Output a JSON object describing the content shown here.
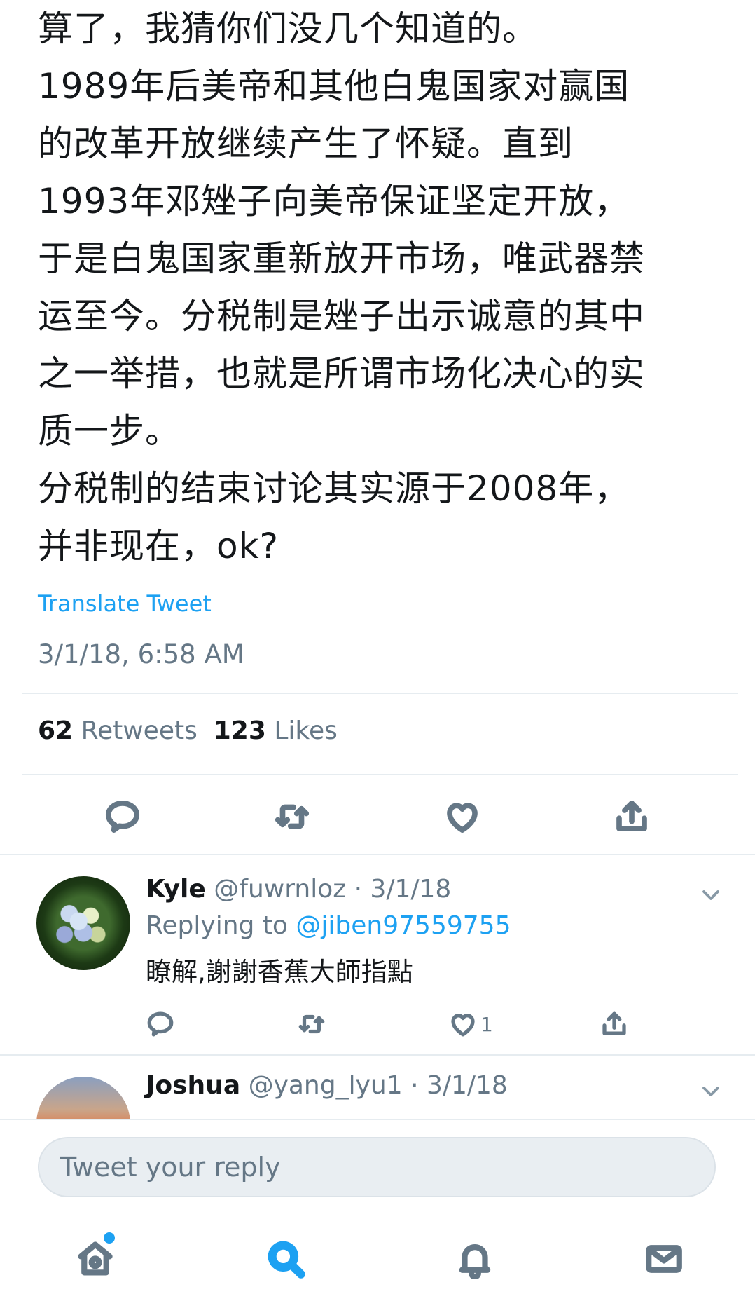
{
  "tweet": {
    "lines": [
      "算了，我猜你们没几个知道的。",
      "1989年后美帝和其他白鬼国家对赢国",
      "的改革开放继续产生了怀疑。直到",
      "1993年邓矬子向美帝保证坚定开放，",
      "于是白鬼国家重新放开市场，唯武器禁",
      "运至今。分税制是矬子出示诚意的其中",
      "之一举措，也就是所谓市场化决心的实",
      "质一步。",
      "分税制的结束讨论其实源于2008年，",
      "并非现在，ok?"
    ],
    "translate_label": "Translate Tweet",
    "timestamp": "3/1/18, 6:58 AM",
    "retweets_count": "62",
    "retweets_label": "Retweets",
    "likes_count": "123",
    "likes_label": "Likes"
  },
  "replies": [
    {
      "name": "Kyle",
      "handle": "@fuwrnloz",
      "date": "· 3/1/18",
      "replying_prefix": "Replying to",
      "replying_handle": "@jiben97559755",
      "text": "瞭解,謝謝香蕉大師指點",
      "like_count": "1"
    },
    {
      "name": "Joshua",
      "handle": "@yang_lyu1",
      "date": "· 3/1/18"
    }
  ],
  "compose": {
    "placeholder": "Tweet your reply"
  },
  "icons": {
    "reply": "reply-icon",
    "retweet": "retweet-icon",
    "like": "like-icon",
    "share": "share-icon",
    "home": "home-icon",
    "search": "search-icon",
    "notifications": "bell-icon",
    "messages": "mail-icon",
    "caret": "chevron-down-icon"
  },
  "colors": {
    "accent": "#1da1f2",
    "text": "#14171a",
    "muted": "#657786",
    "divider": "#e6ecf0"
  }
}
